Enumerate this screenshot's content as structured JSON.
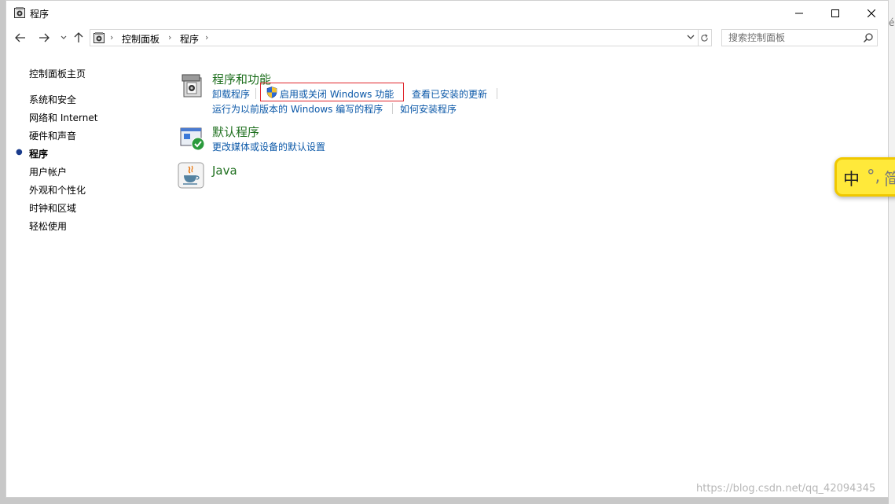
{
  "window": {
    "title": "程序",
    "minimize_label": "—",
    "maximize_label": "☐",
    "close_label": "✕"
  },
  "nav": {
    "back_icon": "back-arrow",
    "forward_icon": "forward-arrow",
    "up_icon": "up-arrow"
  },
  "address": {
    "segments": [
      "控制面板",
      "程序"
    ],
    "separator": "›",
    "dropdown_icon": "chevron-down",
    "refresh_icon": "refresh"
  },
  "search": {
    "placeholder": "搜索控制面板",
    "value": ""
  },
  "leftnav": {
    "home": "控制面板主页",
    "items": [
      {
        "label": "系统和安全",
        "active": false
      },
      {
        "label": "网络和 Internet",
        "active": false
      },
      {
        "label": "硬件和声音",
        "active": false
      },
      {
        "label": "程序",
        "active": true
      },
      {
        "label": "用户帐户",
        "active": false
      },
      {
        "label": "外观和个性化",
        "active": false
      },
      {
        "label": "时钟和区域",
        "active": false
      },
      {
        "label": "轻松使用",
        "active": false
      }
    ]
  },
  "categories": {
    "programs": {
      "title": "程序和功能",
      "links": {
        "uninstall": "卸载程序",
        "windows_features": "启用或关闭 Windows 功能",
        "installed_updates": "查看已安装的更新",
        "compat": "运行为以前版本的 Windows 编写的程序",
        "how_install": "如何安装程序"
      }
    },
    "defaults": {
      "title": "默认程序",
      "links": {
        "change_defaults": "更改媒体或设备的默认设置"
      }
    },
    "java": {
      "title": "Java"
    }
  },
  "ime": {
    "mode": "中",
    "punct": "°,",
    "simp": "简"
  },
  "watermark": "https://blog.csdn.net/qq_42094345",
  "colors": {
    "link": "#0b58a8",
    "category_title": "#1e6f1e",
    "highlight": "#e0262c",
    "ime_bg": "#ffe93a"
  }
}
